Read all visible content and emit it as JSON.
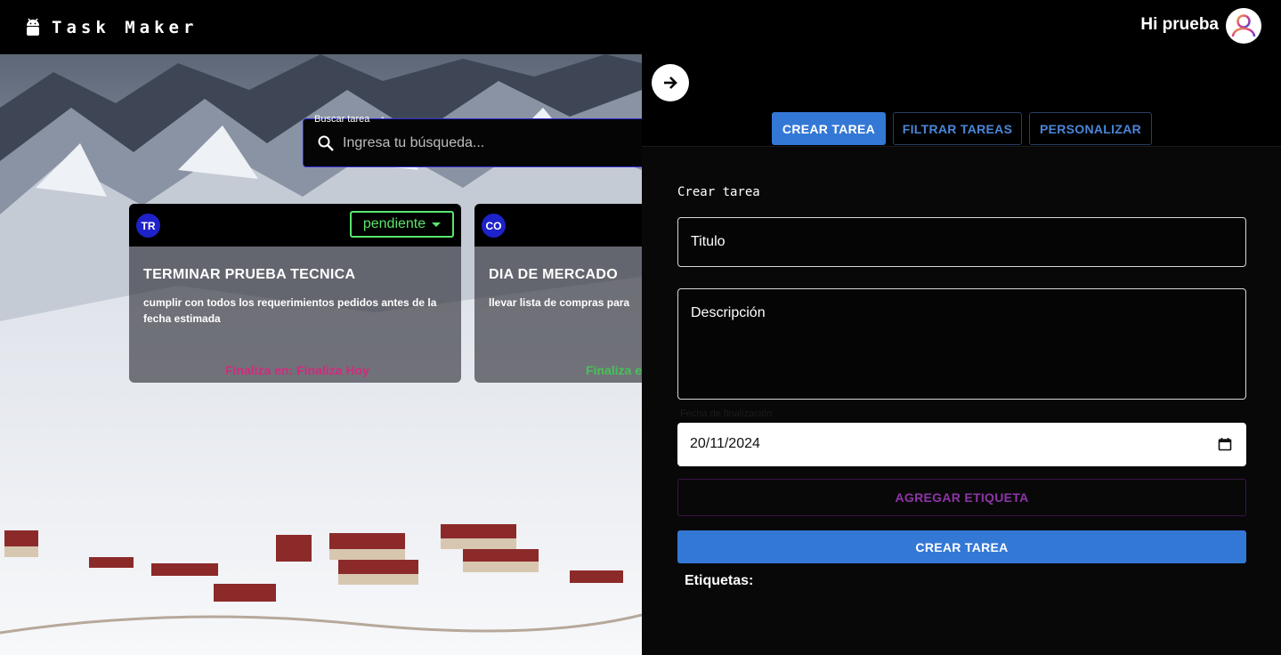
{
  "app": {
    "title": "Task Maker",
    "greeting": "Hi prueba"
  },
  "search": {
    "label": "Buscar tarea",
    "placeholder": "Ingresa tu búsqueda..."
  },
  "cards": [
    {
      "avatar": "TR",
      "status": "pendiente",
      "title": "TERMINAR PRUEBA TECNICA",
      "description": "cumplir con todos los requerimientos pedidos antes de la fecha estimada",
      "footer": "Finaliza en: Finaliza Hoy",
      "footer_color": "#d12b7e"
    },
    {
      "avatar": "CO",
      "title": "DIA DE MERCADO",
      "description": "llevar lista de compras para",
      "footer": "Finaliza e",
      "footer_color": "#46c455"
    }
  ],
  "tabs": [
    {
      "label": "CREAR TAREA",
      "active": true
    },
    {
      "label": "FILTRAR TAREAS",
      "active": false
    },
    {
      "label": "PERSONALIZAR",
      "active": false
    }
  ],
  "form": {
    "heading": "Crear tarea",
    "title_placeholder": "Titulo",
    "description_placeholder": "Descripción",
    "date_label": "Fecha de finalización",
    "date_value": "20/11/2024",
    "add_tag_label": "AGREGAR ETIQUETA",
    "submit_label": "CREAR TAREA",
    "tags_label": "Etiquetas:"
  },
  "colors": {
    "accent_blue": "#3478d6",
    "status_green": "#5be46d",
    "tag_purple": "#8e34a8",
    "card_avatar": "#1e22c9"
  }
}
